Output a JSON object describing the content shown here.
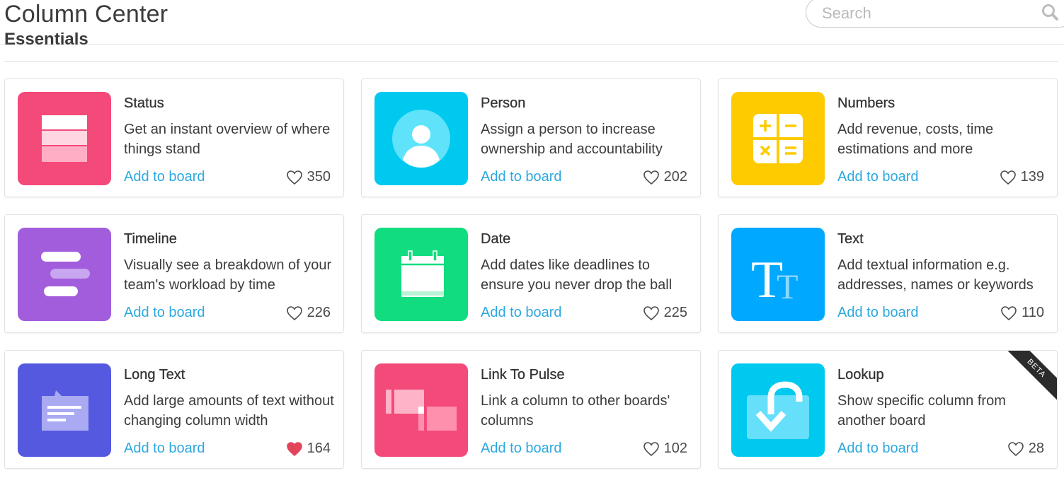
{
  "header": {
    "title": "Column Center",
    "search_placeholder": "Search",
    "search_icon": "search-icon"
  },
  "section": {
    "title": "Essentials"
  },
  "cards": [
    {
      "name": "Status",
      "desc": "Get an instant overview of where things stand",
      "add": "Add to board",
      "likes": "350",
      "liked": false,
      "color": "#f44a7a",
      "icon": "status-icon"
    },
    {
      "name": "Person",
      "desc": "Assign a person to increase ownership and accountability",
      "add": "Add to board",
      "likes": "202",
      "liked": false,
      "color": "#00c9f0",
      "icon": "person-icon"
    },
    {
      "name": "Numbers",
      "desc": "Add revenue, costs, time estimations and more",
      "add": "Add to board",
      "likes": "139",
      "liked": false,
      "color": "#fecb00",
      "icon": "numbers-icon"
    },
    {
      "name": "Timeline",
      "desc": "Visually see a breakdown of your team's workload by time",
      "add": "Add to board",
      "likes": "226",
      "liked": false,
      "color": "#a25ddc",
      "icon": "timeline-icon"
    },
    {
      "name": "Date",
      "desc": "Add dates like deadlines to ensure you never drop the ball",
      "add": "Add to board",
      "likes": "225",
      "liked": false,
      "color": "#11dd80",
      "icon": "calendar-icon"
    },
    {
      "name": "Text",
      "desc": "Add textual information e.g. addresses, names or keywords",
      "add": "Add to board",
      "likes": "110",
      "liked": false,
      "color": "#00a9ff",
      "icon": "text-icon"
    },
    {
      "name": "Long Text",
      "desc": "Add large amounts of text without changing column width",
      "add": "Add to board",
      "likes": "164",
      "liked": true,
      "color": "#5559df",
      "icon": "long-text-icon"
    },
    {
      "name": "Link To Pulse",
      "desc": "Link a column to other boards' columns",
      "add": "Add to board",
      "likes": "102",
      "liked": false,
      "color": "#f44a7a",
      "icon": "link-icon"
    },
    {
      "name": "Lookup",
      "desc": "Show specific column from another board",
      "add": "Add to board",
      "likes": "28",
      "liked": false,
      "color": "#00c9f0",
      "icon": "lookup-icon",
      "badge": "BETA"
    }
  ],
  "colors": {
    "link": "#2da8e0",
    "heart_liked": "#e2445c"
  }
}
